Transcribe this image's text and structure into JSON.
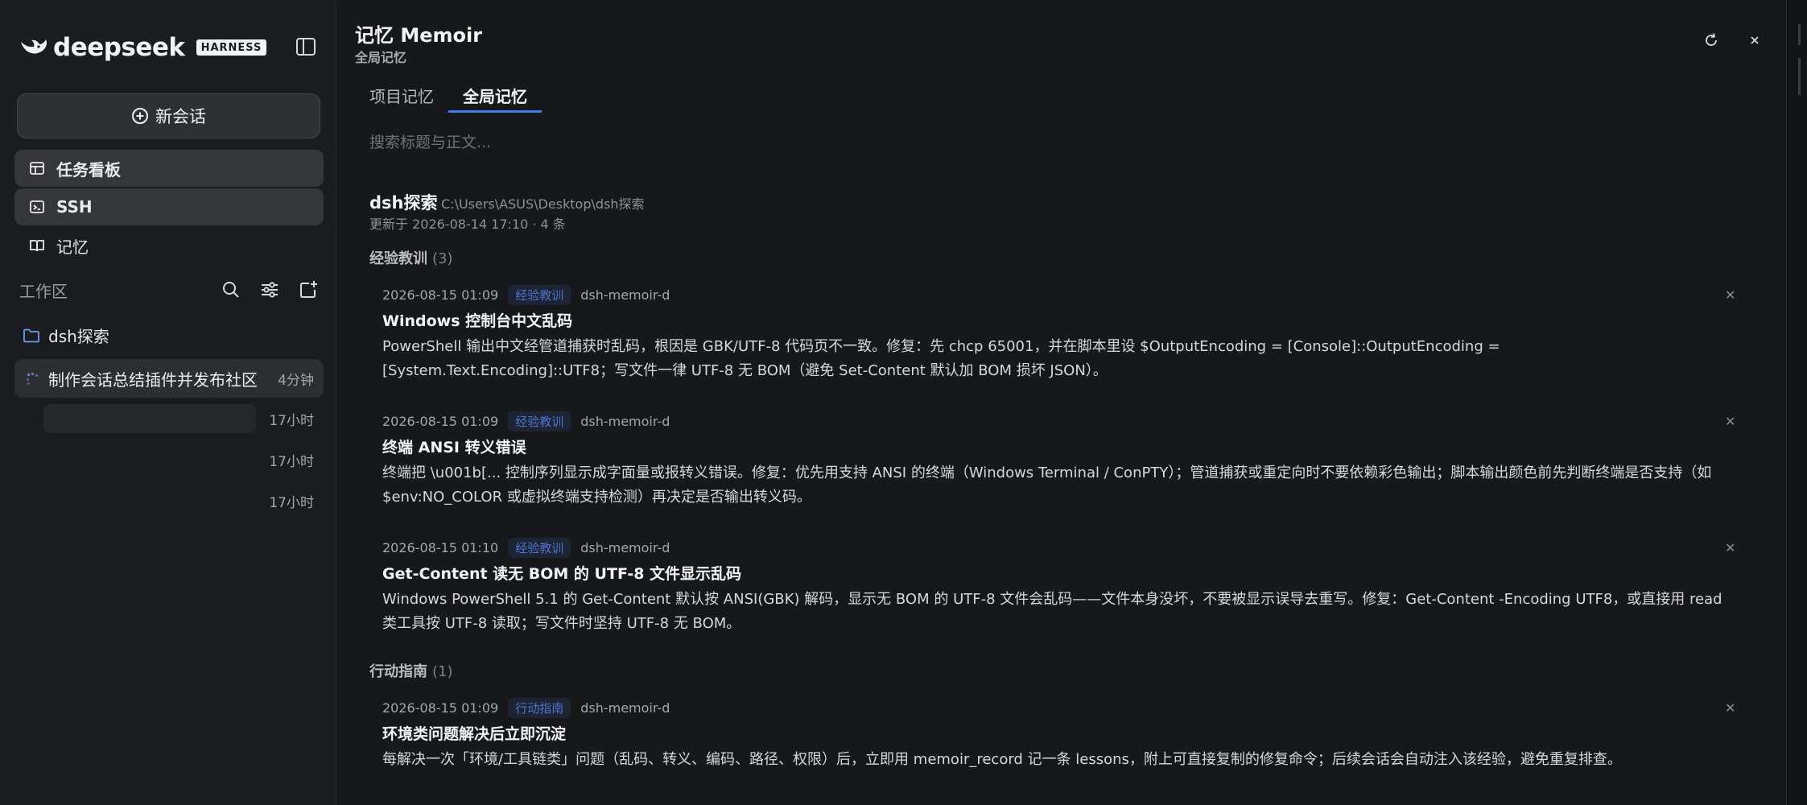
{
  "sidebar": {
    "brand": {
      "wordmark": "deepseek",
      "badge": "HARNESS"
    },
    "new_chat": "新会话",
    "nav": [
      {
        "label": "任务看板",
        "icon": "kanban-icon"
      },
      {
        "label": "SSH",
        "icon": "terminal-icon"
      },
      {
        "label": "记忆",
        "icon": "book-icon"
      }
    ],
    "workspace": {
      "label": "工作区"
    },
    "folder": {
      "label": "dsh探索"
    },
    "sessions": [
      {
        "title": "制作会话总结插件并发布社区",
        "time": "4分钟"
      },
      {
        "title": "",
        "time": "17小时"
      },
      {
        "title": "",
        "time": "17小时"
      },
      {
        "title": "",
        "time": "17小时"
      }
    ]
  },
  "main": {
    "title": "记忆 Memoir",
    "subtitle": "全局记忆",
    "tabs": [
      {
        "label": "项目记忆"
      },
      {
        "label": "全局记忆"
      }
    ],
    "search": {
      "placeholder": "搜索标题与正文..."
    },
    "project": {
      "name": "dsh探索",
      "path": "C:\\Users\\ASUS\\Desktop\\dsh探索",
      "meta": "更新于 2026-08-14 17:10 · 4 条"
    },
    "groups": [
      {
        "label": "经验教训",
        "count": "(3)",
        "entries": [
          {
            "date": "2026-08-15 01:09",
            "tag": "经验教训",
            "source": "dsh-memoir-d",
            "title": "Windows 控制台中文乱码",
            "body": "PowerShell 输出中文经管道捕获时乱码，根因是 GBK/UTF-8 代码页不一致。修复：先 chcp 65001，并在脚本里设 $OutputEncoding = [Console]::OutputEncoding = [System.Text.Encoding]::UTF8；写文件一律 UTF-8 无 BOM（避免 Set-Content 默认加 BOM 损坏 JSON）。"
          },
          {
            "date": "2026-08-15 01:09",
            "tag": "经验教训",
            "source": "dsh-memoir-d",
            "title": "终端 ANSI 转义错误",
            "body": "终端把 \\u001b[... 控制序列显示成字面量或报转义错误。修复：优先用支持 ANSI 的终端（Windows Terminal / ConPTY）；管道捕获或重定向时不要依赖彩色输出；脚本输出颜色前先判断终端是否支持（如 $env:NO_COLOR 或虚拟终端支持检测）再决定是否输出转义码。"
          },
          {
            "date": "2026-08-15 01:10",
            "tag": "经验教训",
            "source": "dsh-memoir-d",
            "title": "Get-Content 读无 BOM 的 UTF-8 文件显示乱码",
            "body": "Windows PowerShell 5.1 的 Get-Content 默认按 ANSI(GBK) 解码，显示无 BOM 的 UTF-8 文件会乱码——文件本身没坏，不要被显示误导去重写。修复：Get-Content -Encoding UTF8，或直接用 read 类工具按 UTF-8 读取；写文件时坚持 UTF-8 无 BOM。"
          }
        ]
      },
      {
        "label": "行动指南",
        "count": "(1)",
        "entries": [
          {
            "date": "2026-08-15 01:09",
            "tag": "行动指南",
            "source": "dsh-memoir-d",
            "title": "环境类问题解决后立即沉淀",
            "body": "每解决一次「环境/工具链类」问题（乱码、转义、编码、路径、权限）后，立即用 memoir_record 记一条 lessons，附上可直接复制的修复命令；后续会话会自动注入该经验，避免重复排查。"
          }
        ]
      }
    ]
  },
  "colors": {
    "accent": "#3d7cf2",
    "tag_text": "#4d74c9",
    "background": "#171819",
    "sidebar": "#1b1c1f"
  }
}
